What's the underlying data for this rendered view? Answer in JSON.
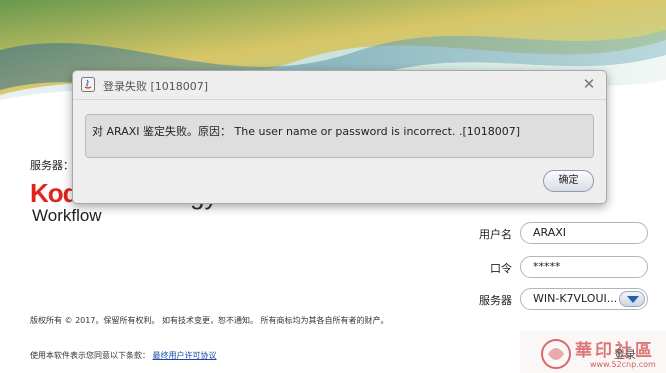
{
  "login": {
    "server_label_top": "服务器：",
    "logo_text": "Kod",
    "logo_tail": "gy",
    "product": "Workflow",
    "copyright": "版权所有 © 2017。保留所有权利。 如有技术变更，恕不通知。 所有商标均为其各自所有者的财产。",
    "agree_text": "使用本软件表示您同意以下条款：",
    "agree_link": "最终用户许可协议",
    "username_label": "用户名",
    "username_value": "ARAXI",
    "password_label": "口令",
    "password_value": "*****",
    "server_label": "服务器",
    "server_value": "WIN-K7VLOUI..."
  },
  "watermark": {
    "text": "華印社區",
    "url": "www.52cnp.com",
    "under_text": "登录"
  },
  "dialog": {
    "title": "登录失败 [1018007]",
    "close_glyph": "✕",
    "message": "对 ARAXI 鉴定失败。原因： The user name or password is incorrect. .[1018007]",
    "ok_label": "确定"
  },
  "colors": {
    "brand_red": "#e2231a",
    "link_blue": "#1a4aa8",
    "select_arrow": "#1f5fb4"
  }
}
